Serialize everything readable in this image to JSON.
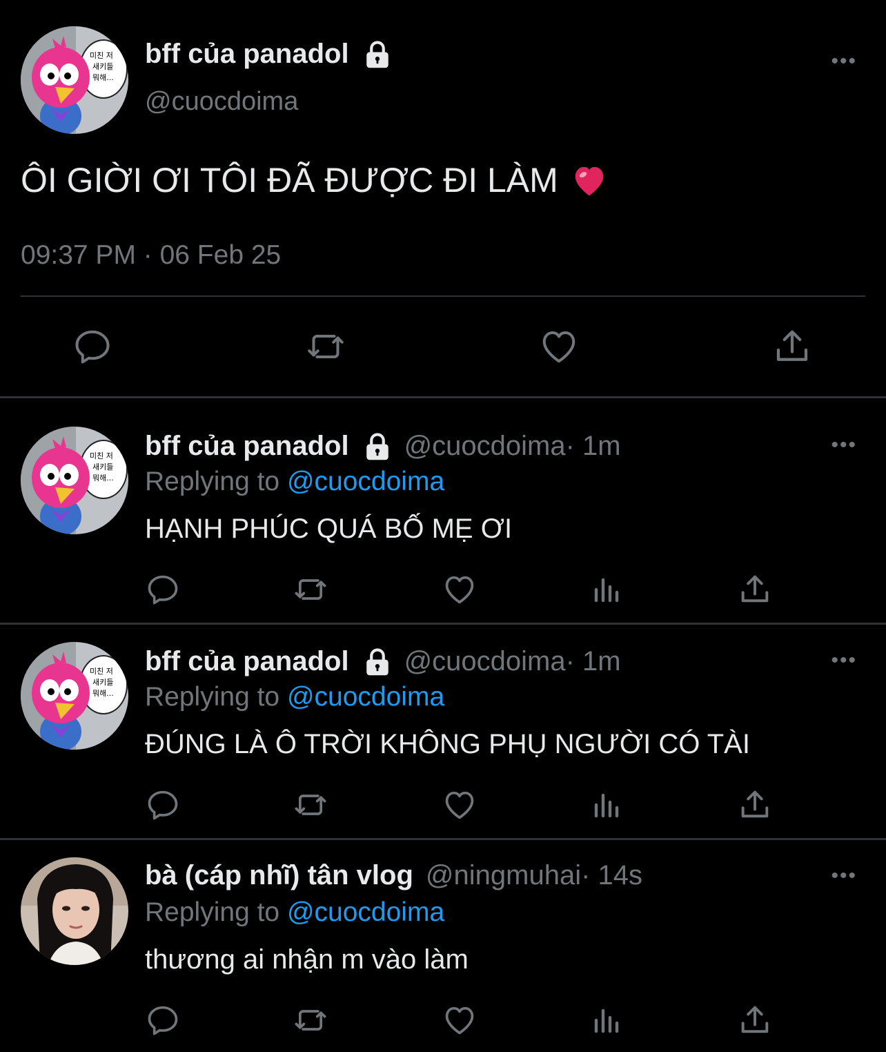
{
  "main_tweet": {
    "author_name": "bff của panadol",
    "author_handle": "@cuocdoima",
    "text": "ÔI GIỜI ƠI TÔI ĐÃ ĐƯỢC ĐI LÀM",
    "emoji": "❤️",
    "timestamp": "09:37 PM · 06 Feb 25",
    "avatar_speech": "미친 저\n새키들\n뭐해...",
    "actions": [
      "reply-icon",
      "retweet-icon",
      "like-icon",
      "share-icon"
    ]
  },
  "replies": [
    {
      "author_name": "bff của panadol",
      "author_handle": "@cuocdoima",
      "time_ago": " · 1m",
      "replying_label": "Replying to ",
      "replying_handle": "@cuocdoima",
      "text": "HẠNH PHÚC QUÁ BỐ MẸ ƠI",
      "locked": true
    },
    {
      "author_name": "bff của panadol",
      "author_handle": "@cuocdoima",
      "time_ago": " · 1m",
      "replying_label": "Replying to ",
      "replying_handle": "@cuocdoima",
      "text": "ĐÚNG LÀ Ô TRỜI KHÔNG PHỤ NGƯỜI CÓ TÀI",
      "locked": true
    },
    {
      "author_name": "bà (cáp nhĩ) tân vlog",
      "author_handle": "@ningmuhai",
      "time_ago": " · 14s",
      "replying_label": "Replying to ",
      "replying_handle": "@cuocdoima",
      "text": "thương ai nhận m vào làm",
      "locked": false
    }
  ],
  "more_label": "•••",
  "colors": {
    "background": "#000000",
    "text": "#e7e9ea",
    "muted": "#71767b",
    "link": "#1d9bf0",
    "divider": "#2f3336"
  }
}
